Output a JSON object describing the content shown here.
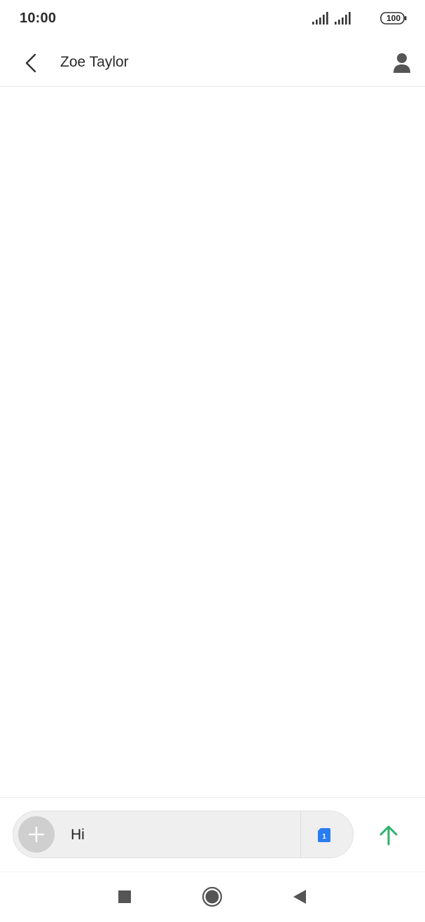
{
  "status_bar": {
    "time": "10:00",
    "battery_level": "100",
    "icons": [
      "signal-icon",
      "signal-icon",
      "battery-icon"
    ]
  },
  "header": {
    "back_icon": "chevron-left-icon",
    "contact_name": "Zoe Taylor",
    "contact_icon": "person-icon"
  },
  "composer": {
    "add_icon": "plus-icon",
    "input_value": "Hi",
    "sim_icon": "sim-card-icon",
    "sim_label": "1",
    "send_icon": "arrow-up-icon"
  },
  "nav_bar": {
    "icons": [
      "square-recents-icon",
      "circle-home-icon",
      "triangle-back-icon"
    ]
  },
  "colors": {
    "send_accent": "#2fb36b",
    "sim_blue": "#2a7df0",
    "icon_gray": "#555555"
  }
}
